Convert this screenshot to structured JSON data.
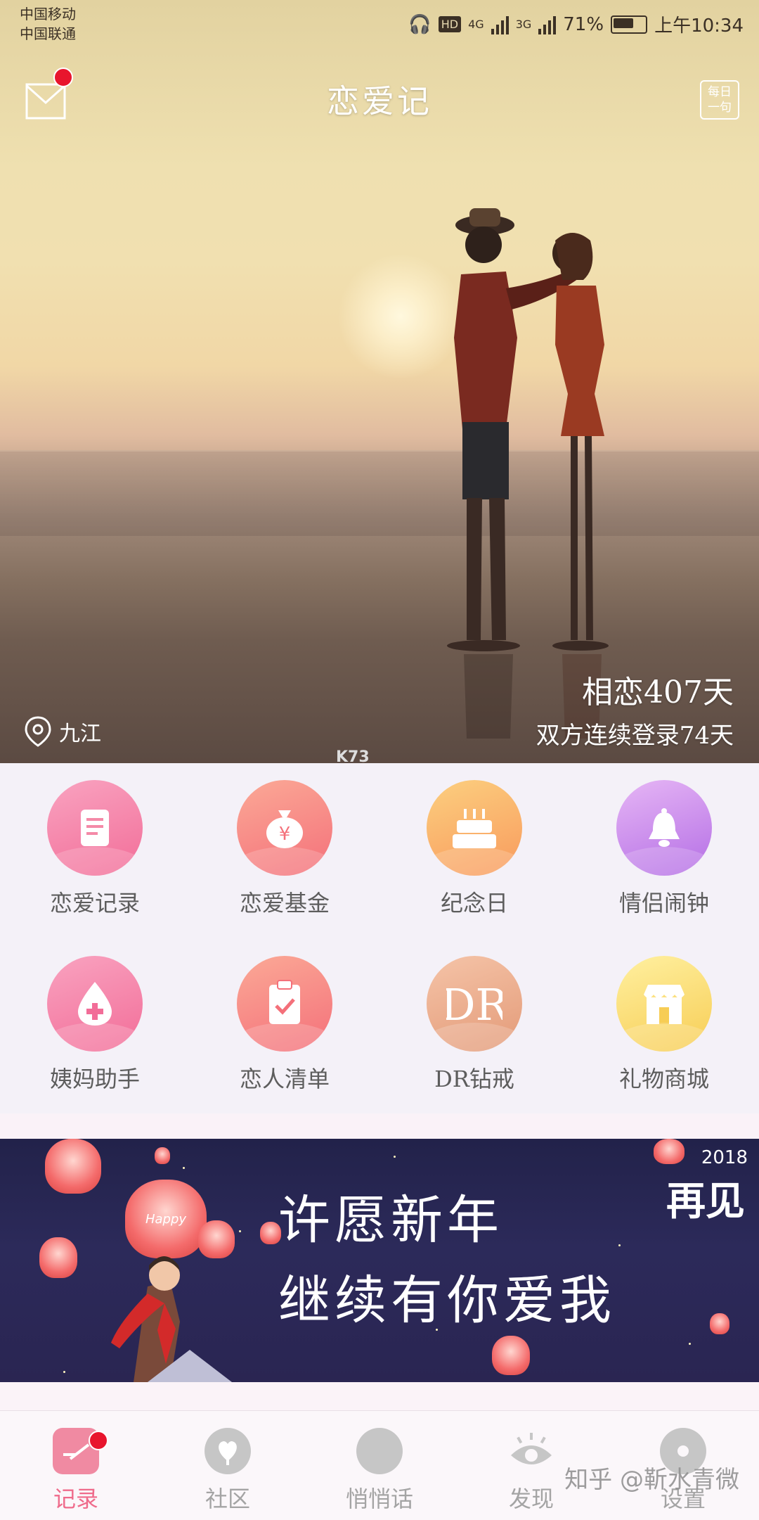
{
  "status_bar": {
    "carrier_1": "中国移动",
    "carrier_2": "中国联通",
    "hd": "HD",
    "net_1": "4G",
    "net_2": "3G",
    "battery_text": "71%",
    "battery_level": 0.71,
    "time": "上午10:34"
  },
  "header": {
    "title": "恋爱记",
    "daily_label": "每日一句",
    "mail_icon": "mail-icon"
  },
  "hero": {
    "location": "九江",
    "days_together": "相恋407天",
    "login_streak": "双方连续登录74天",
    "watermark": "K73"
  },
  "features": [
    {
      "label": "恋爱记录",
      "icon": "notes-icon",
      "colors": [
        "#f9a3c0",
        "#f26d98"
      ]
    },
    {
      "label": "恋爱基金",
      "icon": "money-bag-icon",
      "colors": [
        "#fba996",
        "#f4707a"
      ]
    },
    {
      "label": "纪念日",
      "icon": "cake-icon",
      "colors": [
        "#fccf7f",
        "#f89a5d"
      ]
    },
    {
      "label": "情侣闹钟",
      "icon": "bell-icon",
      "colors": [
        "#e6b6f5",
        "#b46ee5"
      ]
    },
    {
      "label": "姨妈助手",
      "icon": "drop-icon",
      "colors": [
        "#f9a3c0",
        "#f26d98"
      ]
    },
    {
      "label": "恋人清单",
      "icon": "clipboard-icon",
      "colors": [
        "#fba996",
        "#f4707a"
      ]
    },
    {
      "label": "DR钻戒",
      "icon": "dr-logo-icon",
      "colors": [
        "#f5c4a8",
        "#e39a78"
      ]
    },
    {
      "label": "礼物商城",
      "icon": "shop-icon",
      "colors": [
        "#fff0a0",
        "#f7cd55"
      ]
    }
  ],
  "banner": {
    "line1": "许愿新年",
    "line2": "继续有你爱我",
    "corner_text": "再见",
    "corner_year": "2018",
    "lantern_text": "Happy"
  },
  "tabs": [
    {
      "label": "记录",
      "icon": "record-icon",
      "active": true
    },
    {
      "label": "社区",
      "icon": "heart-leaf-icon",
      "active": false
    },
    {
      "label": "悄悄话",
      "icon": "chat-bubble-icon",
      "active": false
    },
    {
      "label": "发现",
      "icon": "eye-icon",
      "active": false
    },
    {
      "label": "设置",
      "icon": "flower-icon",
      "active": false
    }
  ],
  "overlay_watermark": "知乎 @靳水青微",
  "colors": {
    "accent": "#ef6b8b",
    "badge": "#e8152d",
    "banner_bg": "#2c2a5a"
  }
}
